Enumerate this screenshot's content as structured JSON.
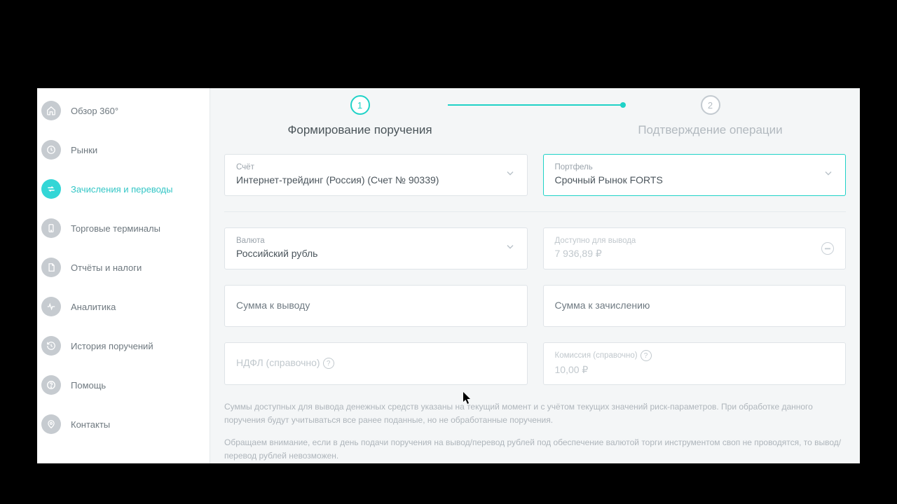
{
  "sidebar": {
    "items": [
      {
        "label": "Обзор 360°",
        "icon": "home"
      },
      {
        "label": "Рынки",
        "icon": "clock"
      },
      {
        "label": "Зачисления и переводы",
        "icon": "transfer",
        "active": true
      },
      {
        "label": "Торговые терминалы",
        "icon": "device"
      },
      {
        "label": "Отчёты и налоги",
        "icon": "doc"
      },
      {
        "label": "Аналитика",
        "icon": "pulse"
      },
      {
        "label": "История поручений",
        "icon": "history"
      },
      {
        "label": "Помощь",
        "icon": "help"
      },
      {
        "label": "Контакты",
        "icon": "pin"
      }
    ]
  },
  "stepper": {
    "step1_num": "1",
    "step1_title": "Формирование поручения",
    "step2_num": "2",
    "step2_title": "Подтверждение операции"
  },
  "form": {
    "account": {
      "label": "Счёт",
      "value": "Интернет-трейдинг (Россия) (Счет № 90339)"
    },
    "portfolio": {
      "label": "Портфель",
      "value": "Срочный Рынок FORTS"
    },
    "currency": {
      "label": "Валюта",
      "value": "Российский рубль"
    },
    "available": {
      "label": "Доступно для вывода",
      "value": "7 936,89 ₽"
    },
    "amount_out": {
      "placeholder": "Сумма к выводу"
    },
    "amount_in": {
      "placeholder": "Сумма к зачислению"
    },
    "ndfl": {
      "placeholder": "НДФЛ (справочно)"
    },
    "commission": {
      "label": "Комиссия (справочно)",
      "value": "10,00 ₽"
    }
  },
  "disclaimer1": "Суммы доступных для вывода денежных средств указаны на текущий момент и с учётом текущих значений риск-параметров. При обработке данного поручения будут учитываться все ранее поданные, но не обработанные поручения.",
  "disclaimer2": "Обращаем внимание, если в день подачи поручения на вывод/перевод рублей под обеспечение валютой торги инструментом своп не проводятся, то вывод/перевод рублей невозможен."
}
